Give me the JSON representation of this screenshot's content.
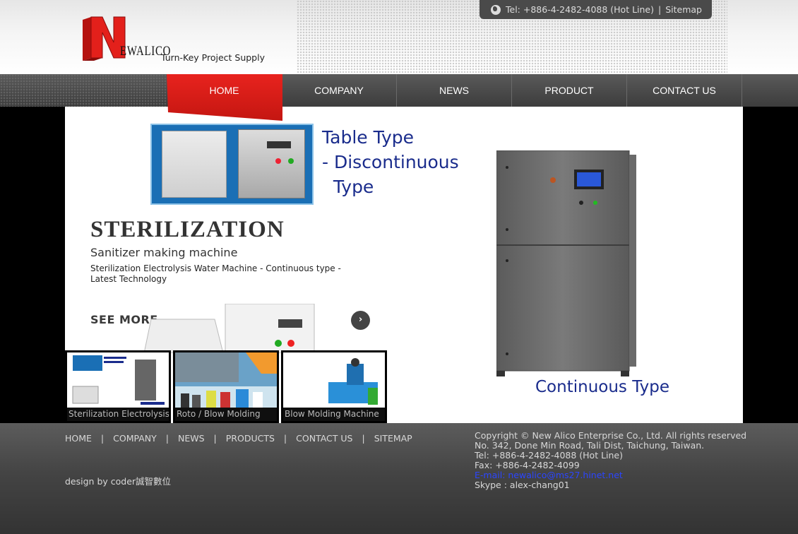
{
  "header": {
    "logo_text": "EWALICO",
    "tagline": "Turn-Key Project Supply",
    "tel": "Tel: +886-4-2482-4088 (Hot Line)",
    "separator": "|",
    "sitemap": "Sitemap"
  },
  "nav": {
    "items": [
      {
        "label": "HOME",
        "active": true
      },
      {
        "label": "COMPANY"
      },
      {
        "label": "NEWS"
      },
      {
        "label": "PRODUCT"
      },
      {
        "label": "CONTACT US"
      }
    ]
  },
  "banner": {
    "table_type": "Table Type\n- Discontinuous\n  Type",
    "title": "STERILIZATION",
    "subtitle": "Sanitizer making machine",
    "description": "Sterilization Electrolysis Water Machine - Continuous type - Latest Technology",
    "see_more": "SEE MORE",
    "next_icon": "chevron-right-icon",
    "continuous_type": "Continuous Type"
  },
  "thumbnails": [
    {
      "caption": "Sterilization Electrolysis"
    },
    {
      "caption": "Roto / Blow Molding"
    },
    {
      "caption": "Blow Molding Machine"
    }
  ],
  "footer": {
    "links": [
      "HOME",
      "COMPANY",
      "NEWS",
      "PRODUCTS",
      "CONTACT US",
      "SITEMAP"
    ],
    "separator": "|",
    "design": "design by coder誠智數位",
    "copyright": "Copyright © New Alico Enterprise Co., Ltd. All rights reserved",
    "address": "No. 342, Done Min Road, Tali Dist, Taichung, Taiwan.",
    "tel": "Tel: +886-4-2482-4088 (Hot Line)",
    "fax": "Fax: +886-4-2482-4099",
    "email": "E-mail: newalico@ms27.hinet.net",
    "skype": "Skype : alex-chang01"
  },
  "colors": {
    "brand_red": "#e3201b",
    "nav_bg": "#4a4a4a",
    "banner_blue_text": "#1a2c8c",
    "email_link": "#2b45ff"
  }
}
